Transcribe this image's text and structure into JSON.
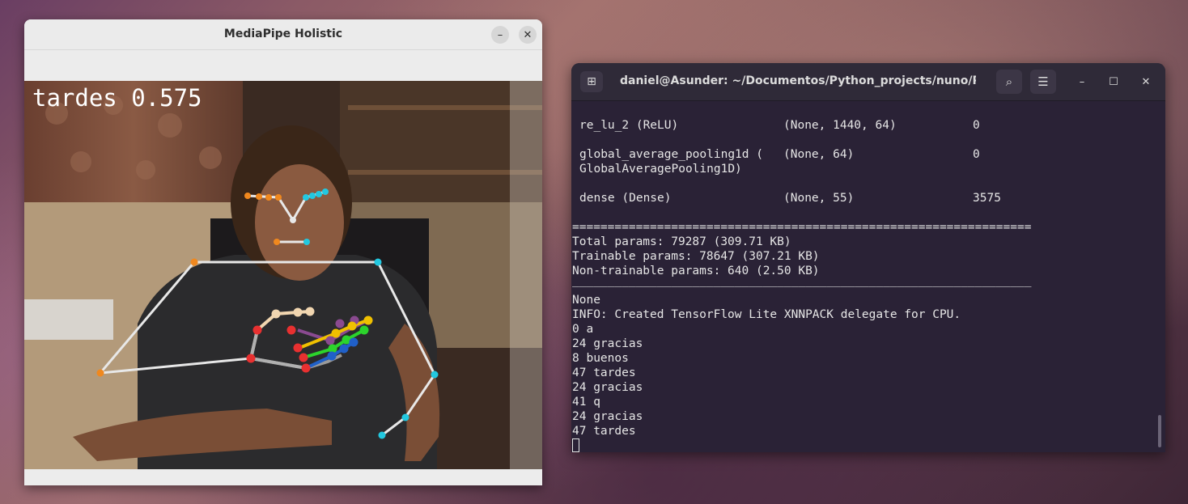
{
  "mediapipe_window": {
    "title": "MediaPipe Holistic",
    "minimize_icon": "minimize-icon",
    "close_icon": "close-icon",
    "prediction_overlay": "tardes 0.575"
  },
  "terminal": {
    "title": "daniel@Asunder: ~/Documentos/Python_projects/nuno/Pro...",
    "icons": [
      "new-tab-icon",
      "search-icon",
      "hamburger-menu-icon",
      "minimize-icon",
      "maximize-icon",
      "close-icon"
    ],
    "layer_rows": [
      {
        "layer": "re_lu_2 (ReLU)",
        "shape": "(None, 1440, 64)",
        "params": "0"
      },
      {
        "layer": "global_average_pooling1d (",
        "shape": "(None, 64)",
        "params": "0",
        "layer_cont": "GlobalAveragePooling1D)"
      },
      {
        "layer": "dense (Dense)",
        "shape": "(None, 55)",
        "params": "3575"
      }
    ],
    "separator_double": "=================================================================",
    "total_params": "Total params: 79287 (309.71 KB)",
    "trainable_params": "Trainable params: 78647 (307.21 KB)",
    "non_trainable_params": "Non-trainable params: 640 (2.50 KB)",
    "separator_single": "_________________________________________________________________",
    "output_lines": [
      "None",
      "INFO: Created TensorFlow Lite XNNPACK delegate for CPU.",
      "0 a",
      "24 gracias",
      "8 buenos",
      "47 tardes",
      "24 gracias",
      "41 q",
      "24 gracias",
      "47 tardes"
    ]
  }
}
